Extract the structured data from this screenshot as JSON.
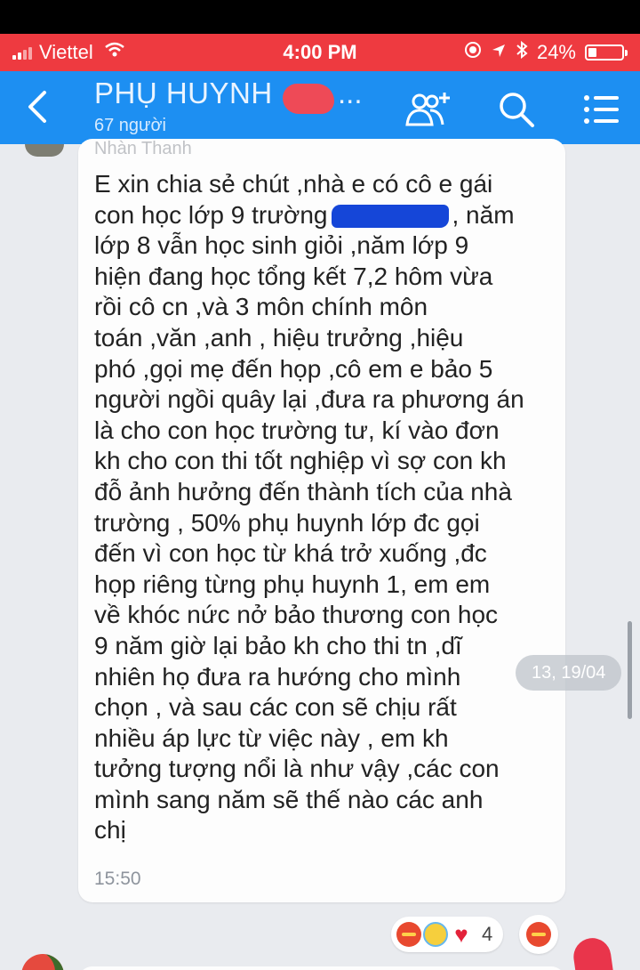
{
  "status_bar": {
    "carrier": "Viettel",
    "time": "4:00 PM",
    "battery_percent": "24%",
    "battery_level": 0.24,
    "icons": [
      "signal-icon",
      "wifi-icon",
      "screen-record-icon",
      "location-icon",
      "bluetooth-icon",
      "battery-icon"
    ]
  },
  "header": {
    "title": "PHỤ HUYNH",
    "title_ellipsis": "...",
    "member_count": "67 người",
    "icons": [
      "back-icon",
      "add-member-icon",
      "search-icon",
      "menu-icon"
    ],
    "colors": {
      "header": "#1d8ff2",
      "status": "#ee3a40"
    }
  },
  "message": {
    "sender": "Nhàn Thanh",
    "lines": [
      "E xin chia sẻ chút ,nhà e có cô e gái",
      "con học lớp 9 trường",
      ", năm",
      "lớp 8 vẫn học sinh giỏi ,năm lớp 9",
      "hiện đang học tổng kết 7,2 hôm vừa",
      "rồi cô cn ,và 3 môn chính môn",
      "toán ,văn ,anh , hiệu trưởng ,hiệu",
      "phó ,gọi mẹ đến họp ,cô em e bảo 5",
      "người ngồi quây lại ,đưa ra phương án",
      "là cho con học trường tư, kí vào đơn",
      "kh cho con thi tốt nghiệp vì sợ con kh",
      "đỗ ảnh hưởng đến thành tích của nhà",
      "trường , 50% phụ huynh lớp đc gọi",
      "đến vì con học từ khá trở xuống ,đc",
      "họp riêng từng phụ huynh 1, em em",
      "về khóc nức nở bảo thương con học",
      "9 năm giờ lại bảo kh cho thi tn ,dĩ",
      "nhiên họ đưa ra hướng cho mình",
      "chọn , và sau các con sẽ chịu rất",
      "nhiều áp lực từ việc này , em kh",
      "tưởng tượng nổi là như vậy ,các con",
      "mình sang năm sẽ thế nào các anh",
      "chị"
    ],
    "time": "15:50",
    "date_pill": "13, 19/04"
  },
  "reactions": {
    "icons": [
      "angry-reaction-icon",
      "laugh-reaction-icon",
      "heart-reaction-icon"
    ],
    "count": "4"
  }
}
